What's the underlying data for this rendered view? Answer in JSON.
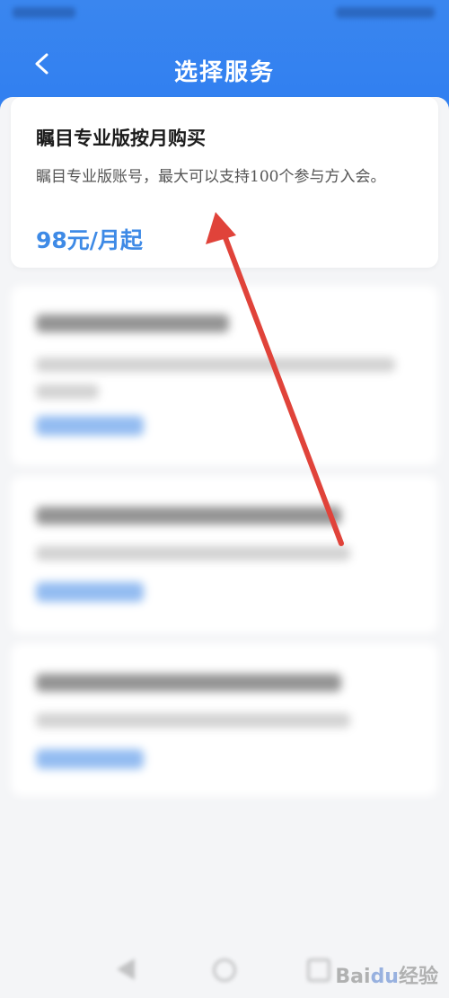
{
  "header": {
    "title": "选择服务",
    "back_icon": "chevron-left-icon"
  },
  "featured_card": {
    "title": "瞩目专业版按月购买",
    "description": "瞩目专业版账号，最大可以支持100个参与方入会。",
    "price": "98元/月起"
  },
  "colors": {
    "header_bg": "#2f7ef0",
    "price": "#3e8ae6",
    "arrow": "#e0433a"
  },
  "watermark": {
    "brand": "Bai",
    "paw": "du",
    "suffix": "经验"
  }
}
